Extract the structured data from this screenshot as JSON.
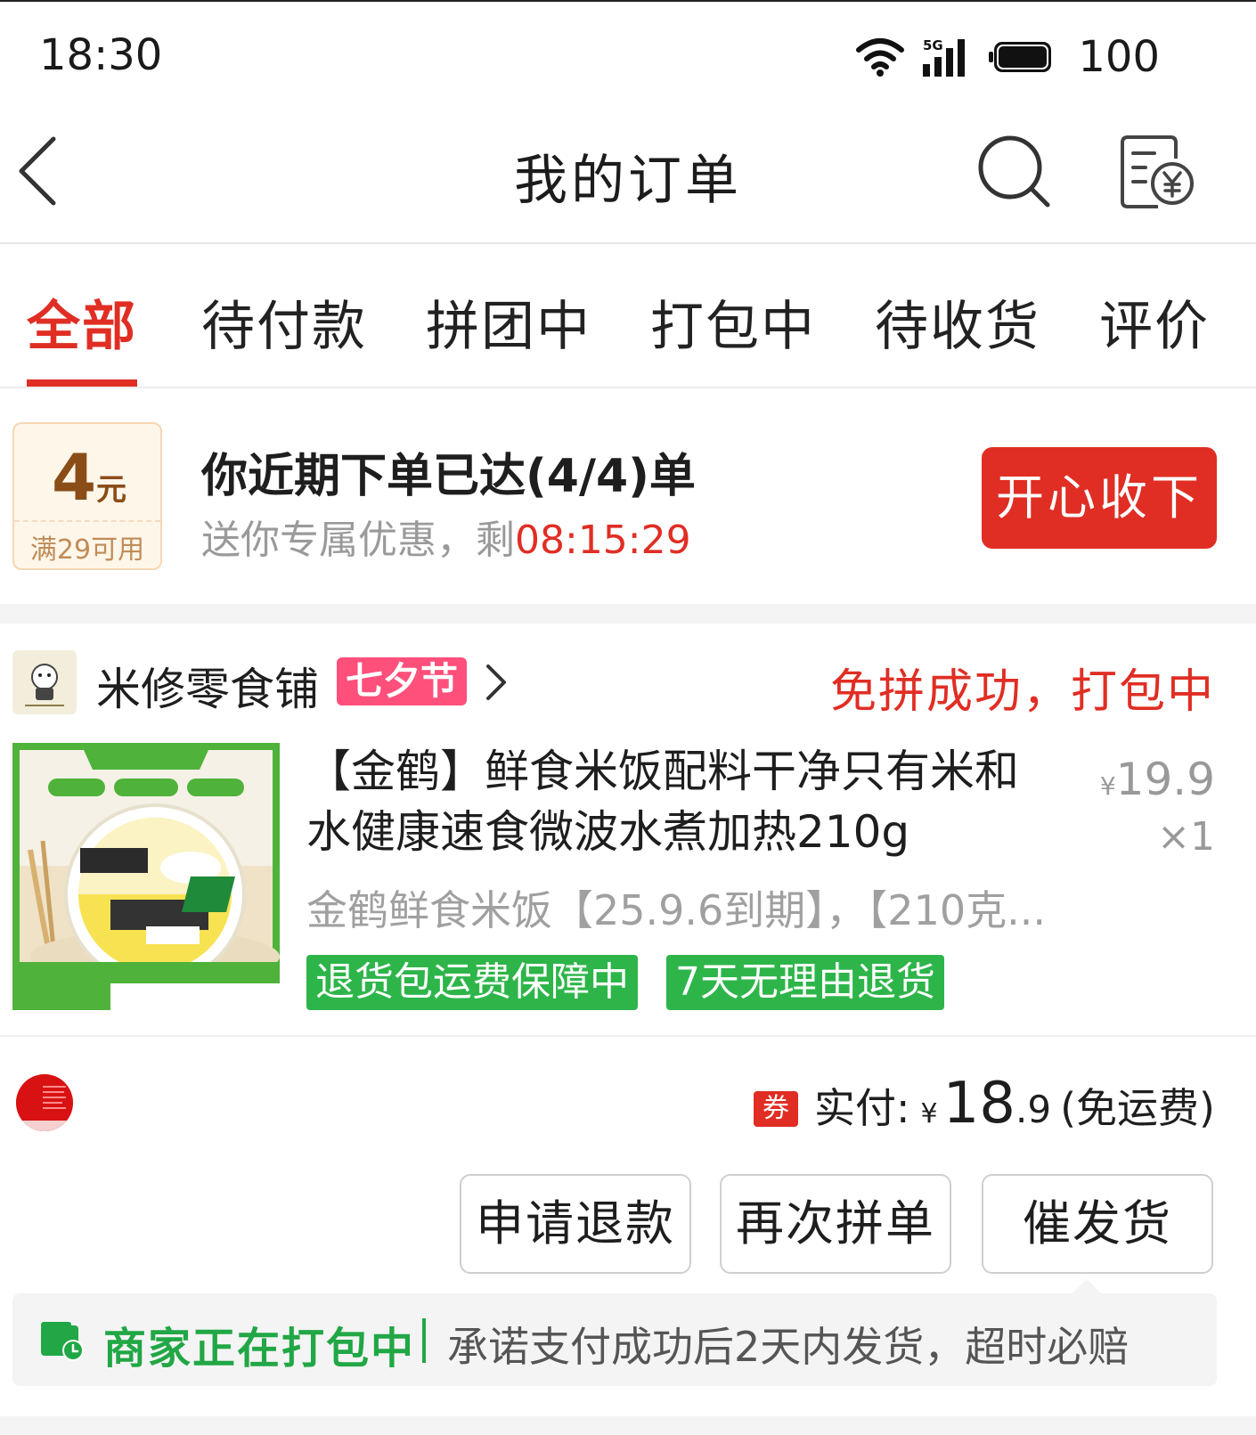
{
  "status_bar": {
    "time": "18:30",
    "network": "5G",
    "battery": "100"
  },
  "header": {
    "title": "我的订单",
    "back_icon": "chevron-left-icon",
    "search_icon": "search-icon",
    "bill_icon": "receipt-yen-icon"
  },
  "tabs": [
    {
      "label": "全部",
      "active": true
    },
    {
      "label": "待付款"
    },
    {
      "label": "拼团中"
    },
    {
      "label": "打包中"
    },
    {
      "label": "待收货"
    },
    {
      "label": "评价"
    }
  ],
  "promo": {
    "coupon_amount": "4",
    "coupon_unit": "元",
    "coupon_condition": "满29可用",
    "title": "你近期下单已达(4/4)单",
    "subtitle": "送你专属优惠，剩",
    "countdown": "08:15:29",
    "button": "开心收下"
  },
  "order": {
    "shop_name": "米修零食铺",
    "shop_tag": "七夕节",
    "status": "免拼成功，打包中",
    "product": {
      "title": "【金鹤】鲜食米饭配料干净只有米和水健康速食微波水煮加热210g",
      "price": "19.9",
      "currency": "¥",
      "quantity": "×1",
      "spec": "金鹤鲜食米饭【25.9.6到期】，【210克...",
      "badges": [
        "退货包运费保障中",
        "7天无理由退货"
      ]
    },
    "payment": {
      "coupon_mark": "券",
      "label": "实付:",
      "currency": "¥",
      "amount_int": "18",
      "amount_dec": ".9",
      "note": "(免运费)"
    },
    "actions": [
      "申请退款",
      "再次拼单",
      "催发货"
    ],
    "shipping": {
      "title": "商家正在打包中",
      "desc": "承诺支付成功后2天内发货，超时必赔"
    }
  },
  "colors": {
    "accent": "#e02e24",
    "green": "#21a745",
    "badge_green": "#2eb54a",
    "tag_pink": "#ff4f7b"
  }
}
